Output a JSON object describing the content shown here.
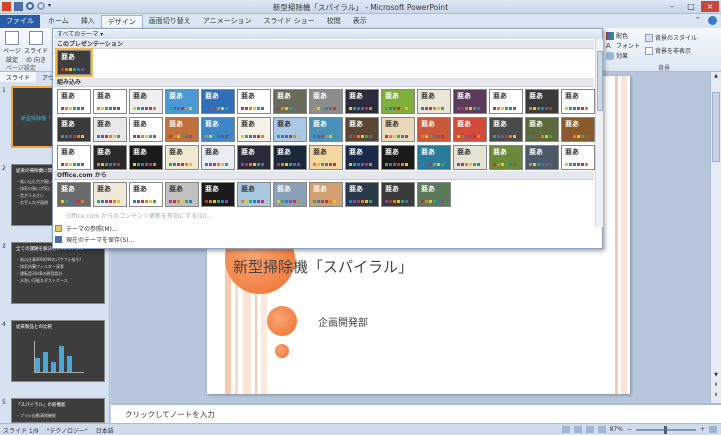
{
  "window": {
    "title": "新型掃除機「スパイラル」 - Microsoft PowerPoint"
  },
  "ribbon": {
    "tabs": [
      "ファイル",
      "ホーム",
      "挿入",
      "デザイン",
      "画面切り替え",
      "アニメーション",
      "スライド ショー",
      "校閲",
      "表示"
    ],
    "active_tab": "デザイン",
    "page_setup": {
      "btn1": "ページ 設定",
      "btn2": "スライドの 向き",
      "group_label": "ページ設定"
    },
    "right": {
      "colors": "配色",
      "fonts": "フォント",
      "effects": "効果",
      "bg_styles": "背景のスタイル",
      "hide_bg": "背景を非表示",
      "group_label": "背景"
    }
  },
  "left_pane": {
    "tabs": [
      "スライド",
      "アウトライン"
    ],
    "slides": [
      {
        "num": "1",
        "title": "新型掃除機「スパイラル」",
        "bullets": []
      },
      {
        "num": "2",
        "title": "従来の掃除機に関する問題点",
        "bullets": [
          "・吸い込む力が弱い",
          "・排気の臭いが気になる",
          "・音がうるさい",
          "・お手入れが面倒"
        ]
      },
      {
        "num": "3",
        "title": "全ての課題を解決したスパイラル",
        "bullets": [
          "・吸込仕事率600Wのパワフル吸引！",
          "・排気内臓フィルター清潔",
          "・運転音30dBの静音設計",
          "・水洗い可能なダストケース"
        ]
      },
      {
        "num": "4",
        "title": "従来製品との比較",
        "bullets": []
      },
      {
        "num": "5",
        "title": "「スパイラル」の新機能",
        "bullets": [
          "・ブラシ自動清掃機能"
        ]
      }
    ]
  },
  "slide": {
    "title": "新型掃除機「スパイラル」",
    "subtitle": "企画開発部"
  },
  "notes": {
    "placeholder": "クリックしてノートを入力"
  },
  "status": {
    "slide_num": "スライド 1/9",
    "theme": "\"テクノロジー\"",
    "lang": "日本語",
    "zoom": "87%"
  },
  "gallery": {
    "header": "すべてのテーマ ▾",
    "sec_current": "このプレゼンテーション",
    "sec_builtin": "組み込み",
    "sec_office": "Office.com から",
    "aa": "亜あ",
    "menu": {
      "disable_updates": "Office.com からのコンテンツ更新を有効にする(O)...",
      "browse": "テーマの参照(M)...",
      "save": "現在のテーマを保存(S)..."
    },
    "themes_builtin": [
      [
        "#ffffff",
        "#333"
      ],
      [
        "#ffffff",
        "#333"
      ],
      [
        "#f0f0f0",
        "#333"
      ],
      [
        "#4a9ad4",
        "#fff"
      ],
      [
        "#2e6fb7",
        "#fff"
      ],
      [
        "#ffffff",
        "#333"
      ],
      [
        "#6a6a5a",
        "#fff"
      ],
      [
        "#8c8c8c",
        "#fff"
      ],
      [
        "#2b2b3e",
        "#fff"
      ],
      [
        "#7fae3a",
        "#fff"
      ],
      [
        "#ece6d6",
        "#333"
      ],
      [
        "#5b3a5a",
        "#fff"
      ],
      [
        "#ffffff",
        "#333"
      ],
      [
        "#3a3a3a",
        "#fff"
      ],
      [
        "#ffffff",
        "#333"
      ],
      [
        "#3a3a3a",
        "#fff"
      ],
      [
        "#e8e8e8",
        "#333"
      ],
      [
        "#ffffff",
        "#333"
      ],
      [
        "#c0703a",
        "#fff"
      ],
      [
        "#3e87c7",
        "#fff"
      ],
      [
        "#f4f1e6",
        "#333"
      ],
      [
        "#aac8e8",
        "#333"
      ],
      [
        "#4a90b8",
        "#fff"
      ],
      [
        "#5a4632",
        "#fff"
      ],
      [
        "#e9d9b9",
        "#333"
      ],
      [
        "#c85a3a",
        "#fff"
      ],
      [
        "#d24a3a",
        "#fff"
      ],
      [
        "#4a4a4a",
        "#fff"
      ],
      [
        "#5a6a3a",
        "#fff"
      ],
      [
        "#8a5a2a",
        "#fff"
      ],
      [
        "#ffffff",
        "#333"
      ],
      [
        "#2a2a2a",
        "#fff"
      ],
      [
        "#1a1a1a",
        "#fff"
      ],
      [
        "#f0e8d0",
        "#333"
      ],
      [
        "#e8eef4",
        "#333"
      ],
      [
        "#2a2a3a",
        "#fff"
      ],
      [
        "#1a2a3a",
        "#fff"
      ],
      [
        "#f3d6a0",
        "#333"
      ],
      [
        "#1a2a4a",
        "#fff"
      ],
      [
        "#1a1a1a",
        "#fff"
      ],
      [
        "#2a7a9a",
        "#fff"
      ],
      [
        "#e7e3d4",
        "#333"
      ],
      [
        "#6a8a3a",
        "#fff"
      ],
      [
        "#4a5a6a",
        "#fff"
      ],
      [
        "#ffffff",
        "#333"
      ]
    ],
    "themes_office": [
      [
        "#6a6a6a",
        "#fff"
      ],
      [
        "#f0e8d8",
        "#333"
      ],
      [
        "#ffffff",
        "#333"
      ],
      [
        "#c0c0c0",
        "#333"
      ],
      [
        "#1a1a1a",
        "#fff"
      ],
      [
        "#a8c8e0",
        "#333"
      ],
      [
        "#8aa0b8",
        "#fff"
      ],
      [
        "#d0a070",
        "#fff"
      ],
      [
        "#2a3a4a",
        "#fff"
      ],
      [
        "#3a3a3a",
        "#fff"
      ],
      [
        "#5a7a5a",
        "#fff"
      ]
    ]
  },
  "colors": {
    "accent": "#ef6f2e",
    "file_tab": "#2a5ba8",
    "selection": "#f3a73a"
  }
}
